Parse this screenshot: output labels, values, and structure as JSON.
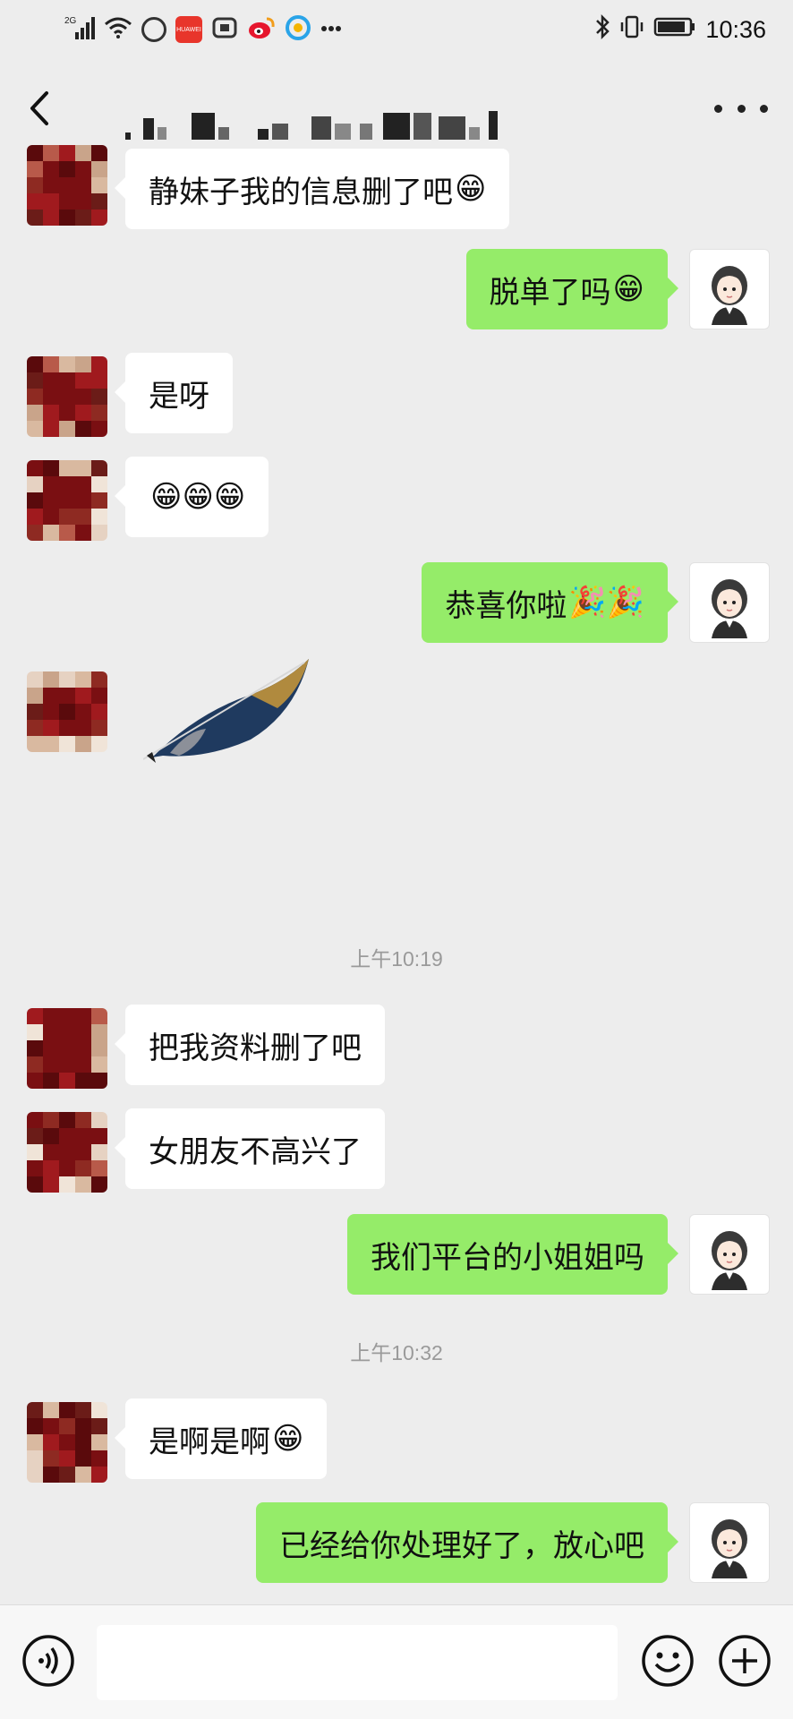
{
  "status_bar": {
    "network": "2G",
    "time": "10:36",
    "app_badge": "HUAWEI"
  },
  "header": {
    "back_icon": "chevron-left-icon",
    "title": "",
    "more_icon": "more-dots-icon"
  },
  "messages": [
    {
      "side": "in",
      "text": "静妹子我的信息删了吧",
      "emoji": "😁"
    },
    {
      "side": "out",
      "text": "脱单了吗",
      "emoji": "😁"
    },
    {
      "side": "in",
      "text": "是呀",
      "emoji": ""
    },
    {
      "side": "in",
      "text": "",
      "emoji": "😁😁😁"
    },
    {
      "side": "out",
      "text": "恭喜你啦",
      "emoji": "🎉🎉"
    },
    {
      "side": "in",
      "type": "sticker",
      "sticker": "feather-sticker"
    },
    {
      "type": "time",
      "text": "上午10:19"
    },
    {
      "side": "in",
      "text": "把我资料删了吧",
      "emoji": ""
    },
    {
      "side": "in",
      "text": "女朋友不高兴了",
      "emoji": ""
    },
    {
      "side": "out",
      "text": "我们平台的小姐姐吗",
      "emoji": ""
    },
    {
      "type": "time",
      "text": "上午10:32"
    },
    {
      "side": "in",
      "text": "是啊是啊",
      "emoji": "😁"
    },
    {
      "side": "out",
      "text": "已经给你处理好了，放心吧",
      "emoji": ""
    }
  ],
  "input_bar": {
    "voice_icon": "voice-icon",
    "placeholder": "",
    "emoji_icon": "emoji-icon",
    "plus_icon": "plus-icon"
  },
  "colors": {
    "background": "#ededed",
    "outgoing_bubble": "#95ec69",
    "incoming_bubble": "#ffffff",
    "timestamp": "#9a9a9a"
  }
}
